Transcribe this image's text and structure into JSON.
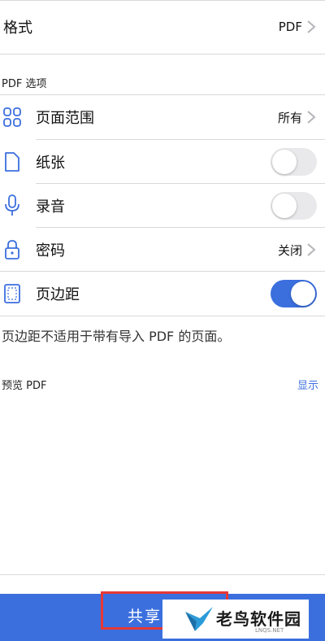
{
  "format": {
    "label": "格式",
    "value": "PDF"
  },
  "pdf_options": {
    "section_title": "PDF 选项",
    "items": [
      {
        "label": "页面范围",
        "value": "所有",
        "icon": "grid-icon"
      },
      {
        "label": "纸张",
        "toggle": false,
        "icon": "page-icon"
      },
      {
        "label": "录音",
        "toggle": false,
        "icon": "microphone-icon"
      },
      {
        "label": "密码",
        "value": "关闭",
        "icon": "lock-icon"
      },
      {
        "label": "页边距",
        "toggle": true,
        "icon": "margin-icon"
      }
    ],
    "note": "页边距不适用于带有导入 PDF 的页面。"
  },
  "preview": {
    "title": "预览 PDF",
    "link": "显示"
  },
  "share": {
    "label": "共享"
  },
  "watermark": {
    "brand": "老鸟软件园",
    "domain": "LNQS.NET"
  },
  "colors": {
    "accent": "#3b6fde",
    "highlight": "#e53935",
    "separator": "#d9d9de",
    "toggle_off": "#e9e9eb"
  }
}
